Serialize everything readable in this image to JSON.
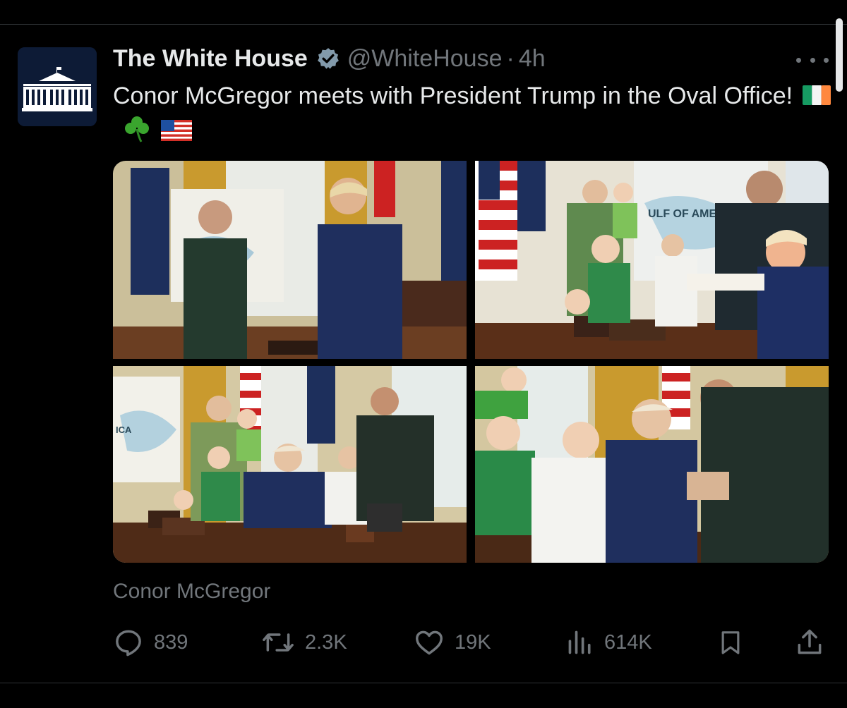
{
  "tweet": {
    "display_name": "The White House",
    "handle": "@WhiteHouse",
    "separator": "·",
    "time": "4h",
    "text": "Conor McGregor meets with President Trump in the Oval Office!",
    "emoji": [
      "ireland-flag",
      "shamrock",
      "us-flag"
    ],
    "caption": "Conor McGregor"
  },
  "actions": {
    "replies": "839",
    "reposts": "2.3K",
    "likes": "19K",
    "views": "614K"
  },
  "photos": {
    "p2_map_label": "ULF OF AMERICA",
    "p3_map_label": "ICA"
  },
  "colors": {
    "background": "#000000",
    "text": "#e7e9ea",
    "muted": "#71767b",
    "divider": "#2f3336"
  }
}
